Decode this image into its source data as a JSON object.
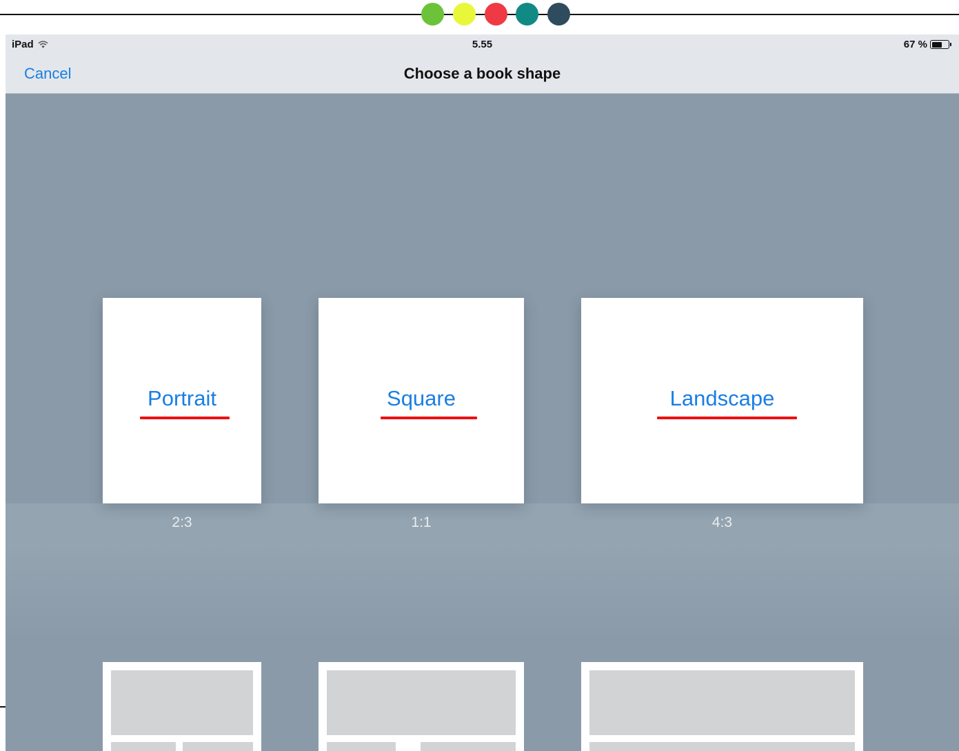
{
  "decoration": {
    "dot_colors": [
      "#6cc33a",
      "#e9f73b",
      "#ef3a45",
      "#118a86",
      "#2f4b5e"
    ]
  },
  "status_bar": {
    "device": "iPad",
    "time": "5.55",
    "battery_text": "67 %",
    "battery_level": 0.67
  },
  "nav": {
    "cancel_label": "Cancel",
    "title": "Choose a book shape"
  },
  "shapes": [
    {
      "label": "Portrait",
      "ratio": "2:3"
    },
    {
      "label": "Square",
      "ratio": "1:1"
    },
    {
      "label": "Landscape",
      "ratio": "4:3"
    }
  ],
  "colors": {
    "accent": "#1a7ee3",
    "annotation": "#ee1111",
    "background": "#8a9aa8"
  }
}
